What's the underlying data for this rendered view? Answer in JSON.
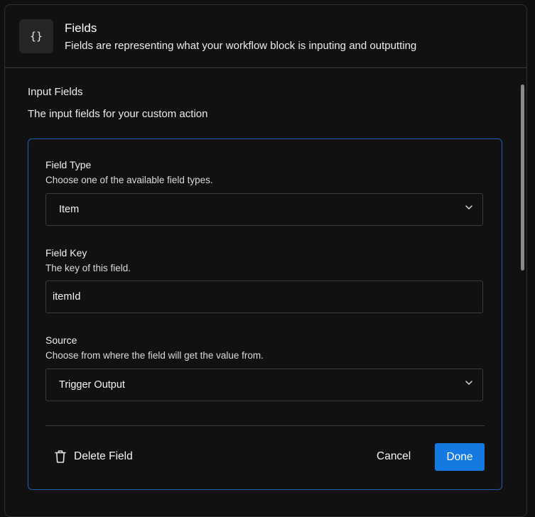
{
  "header": {
    "icon_glyph": "{}",
    "icon_name": "braces-icon",
    "title": "Fields",
    "subtitle": "Fields are representing what your workflow block is inputing and outputting"
  },
  "section": {
    "title": "Input Fields",
    "description": "The input fields for your custom action"
  },
  "card": {
    "field_type": {
      "label": "Field Type",
      "help": "Choose one of the available field types.",
      "value": "Item"
    },
    "field_key": {
      "label": "Field Key",
      "help": "The key of this field.",
      "value": "itemId"
    },
    "source": {
      "label": "Source",
      "help": "Choose from where the field will get the value from.",
      "value": "Trigger Output"
    },
    "actions": {
      "delete_label": "Delete Field",
      "cancel_label": "Cancel",
      "done_label": "Done"
    }
  },
  "colors": {
    "accent": "#1479e0",
    "card_border": "#1f5fb3",
    "background": "#111111"
  }
}
